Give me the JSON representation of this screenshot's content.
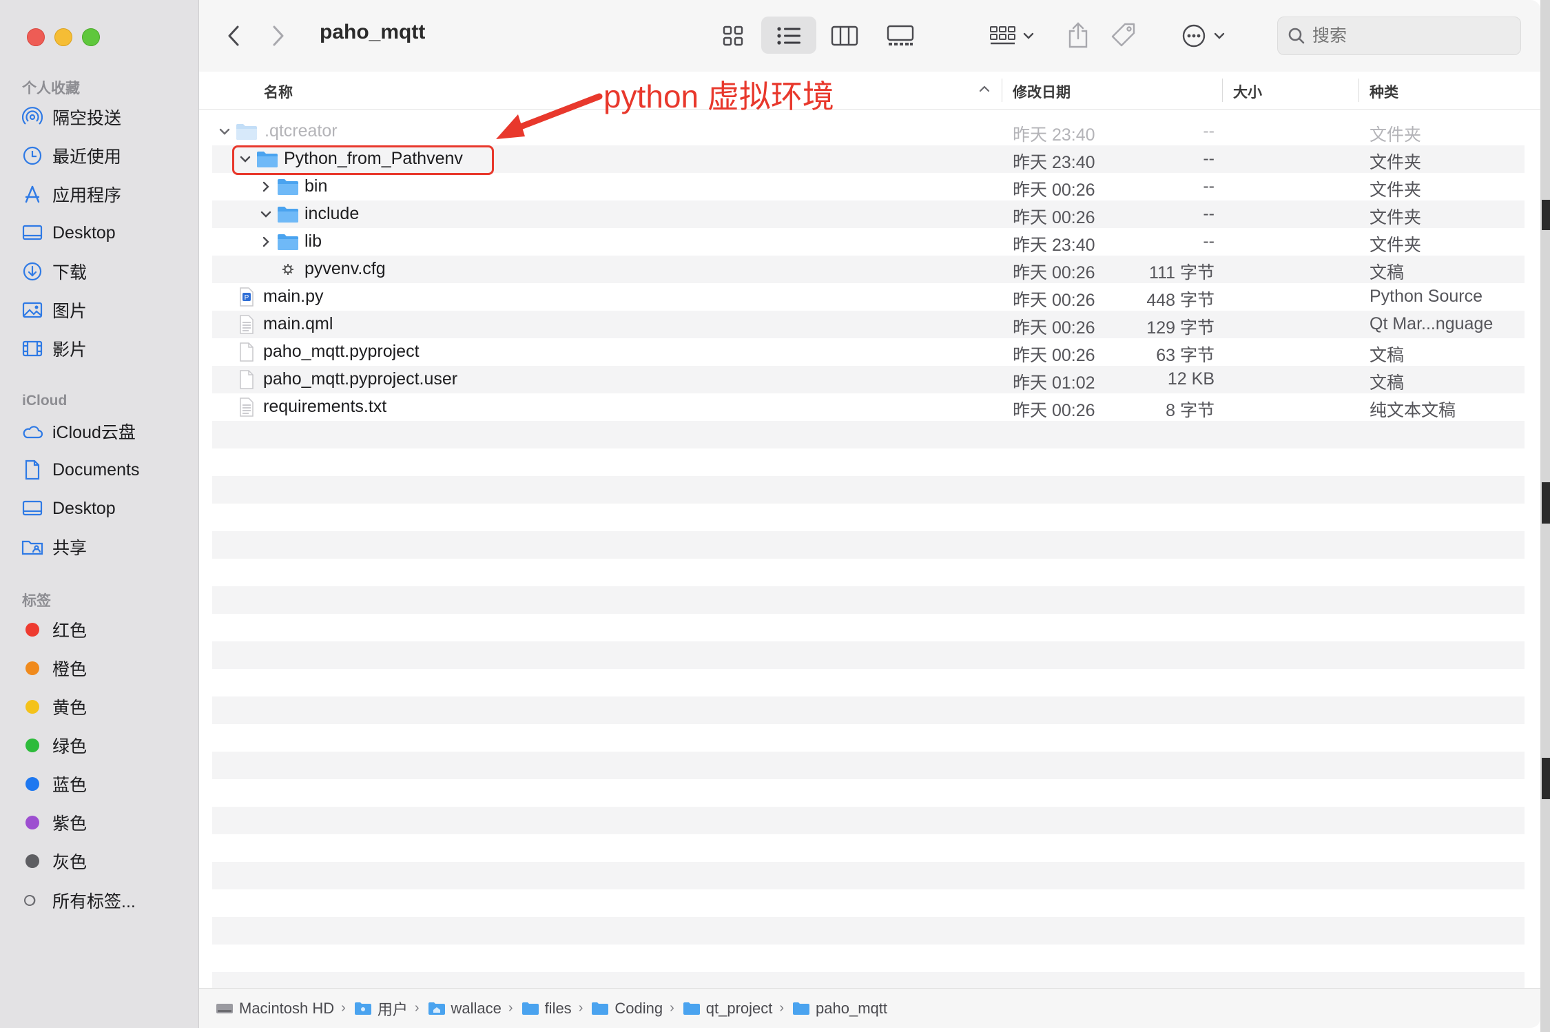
{
  "window": {
    "title": "paho_mqtt"
  },
  "sidebar": {
    "favorites_header": "个人收藏",
    "favorites": [
      {
        "label": "隔空投送",
        "icon": "airdrop-icon"
      },
      {
        "label": "最近使用",
        "icon": "clock-icon"
      },
      {
        "label": "应用程序",
        "icon": "applications-icon"
      },
      {
        "label": "Desktop",
        "icon": "desktop-icon"
      },
      {
        "label": "下载",
        "icon": "download-icon"
      },
      {
        "label": "图片",
        "icon": "photo-icon"
      },
      {
        "label": "影片",
        "icon": "film-icon"
      }
    ],
    "icloud_header": "iCloud",
    "icloud": [
      {
        "label": "iCloud云盘",
        "icon": "cloud-icon"
      },
      {
        "label": "Documents",
        "icon": "document-icon"
      },
      {
        "label": "Desktop",
        "icon": "desktop-icon"
      },
      {
        "label": "共享",
        "icon": "shared-folder-icon"
      }
    ],
    "tags_header": "标签",
    "tags": [
      {
        "label": "红色",
        "color": "#ee3b30"
      },
      {
        "label": "橙色",
        "color": "#f08a1c"
      },
      {
        "label": "黄色",
        "color": "#f4c21a"
      },
      {
        "label": "绿色",
        "color": "#2dbb3b"
      },
      {
        "label": "蓝色",
        "color": "#1e78f0"
      },
      {
        "label": "紫色",
        "color": "#9d4fd0"
      },
      {
        "label": "灰色",
        "color": "#8a8a8e"
      }
    ],
    "all_tags_label": "所有标签..."
  },
  "search": {
    "placeholder": "搜索"
  },
  "columns": {
    "name": "名称",
    "date": "修改日期",
    "size": "大小",
    "kind": "种类"
  },
  "annotation": {
    "text": "python 虚拟环境",
    "color": "#e8382c"
  },
  "rows": [
    {
      "name": ".qtcreator",
      "date": "昨天 23:40",
      "size": "--",
      "kind": "文件夹"
    },
    {
      "name": "Python_from_Pathvenv",
      "date": "昨天 23:40",
      "size": "--",
      "kind": "文件夹"
    },
    {
      "name": "bin",
      "date": "昨天 00:26",
      "size": "--",
      "kind": "文件夹"
    },
    {
      "name": "include",
      "date": "昨天 00:26",
      "size": "--",
      "kind": "文件夹"
    },
    {
      "name": "lib",
      "date": "昨天 23:40",
      "size": "--",
      "kind": "文件夹"
    },
    {
      "name": "pyvenv.cfg",
      "date": "昨天 00:26",
      "size": "111 字节",
      "kind": "文稿"
    },
    {
      "name": "main.py",
      "date": "昨天 00:26",
      "size": "448 字节",
      "kind": "Python Source"
    },
    {
      "name": "main.qml",
      "date": "昨天 00:26",
      "size": "129 字节",
      "kind": "Qt Mar...nguage"
    },
    {
      "name": "paho_mqtt.pyproject",
      "date": "昨天 00:26",
      "size": "63 字节",
      "kind": "文稿"
    },
    {
      "name": "paho_mqtt.pyproject.user",
      "date": "昨天 01:02",
      "size": "12 KB",
      "kind": "文稿"
    },
    {
      "name": "requirements.txt",
      "date": "昨天 00:26",
      "size": "8 字节",
      "kind": "纯文本文稿"
    }
  ],
  "path": [
    "Macintosh HD",
    "用户",
    "wallace",
    "files",
    "Coding",
    "qt_project",
    "paho_mqtt"
  ]
}
